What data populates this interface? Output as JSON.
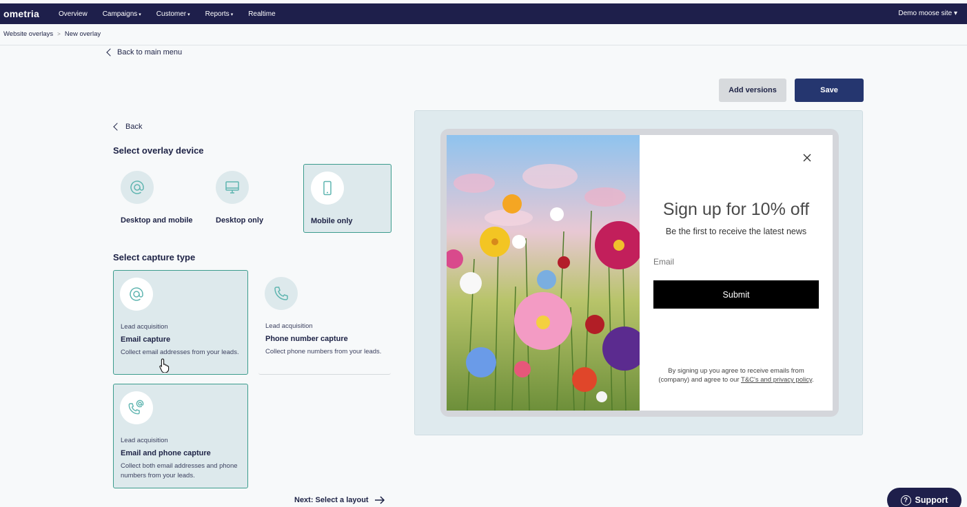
{
  "nav": {
    "logo": "ometria",
    "items": [
      "Overview",
      "Campaigns",
      "Customer",
      "Reports",
      "Realtime"
    ],
    "site": "Demo moose site"
  },
  "breadcrumb": [
    "Website overlays",
    "New overlay"
  ],
  "back_main": "Back to main menu",
  "actions": {
    "add_versions": "Add versions",
    "save": "Save"
  },
  "back": "Back",
  "device_section": {
    "title": "Select overlay device",
    "options": [
      {
        "label": "Desktop and mobile",
        "icon": "at-icon"
      },
      {
        "label": "Desktop only",
        "icon": "monitor-icon"
      },
      {
        "label": "Mobile only",
        "icon": "phone-icon",
        "selected": true
      }
    ]
  },
  "capture_section": {
    "title": "Select capture type",
    "options": [
      {
        "kicker": "Lead acquisition",
        "title": "Email capture",
        "desc": "Collect email addresses from your leads.",
        "icon": "at-icon",
        "selected": true
      },
      {
        "kicker": "Lead acquisition",
        "title": "Phone number capture",
        "desc": "Collect phone numbers from your leads.",
        "icon": "phone-call-icon"
      },
      {
        "kicker": "Lead acquisition",
        "title": "Email and phone capture",
        "desc": "Collect both email addresses and phone numbers from your leads.",
        "icon": "phone-at-icon",
        "selected": true
      }
    ]
  },
  "next": "Next: Select a layout",
  "preview": {
    "title": "Sign up for 10% off",
    "subtitle": "Be the first to receive the latest news",
    "email_placeholder": "Email",
    "submit": "Submit",
    "terms_text": "By signing up you agree to receive emails from (company) and agree to our",
    "terms_link": "T&C's and privacy policy"
  },
  "support": "Support",
  "colors": {
    "nav_bg": "#1e1f4b",
    "selected_bg": "#dde9ec",
    "selected_border": "#3a9b8c",
    "save_btn": "#25366f",
    "icon_teal": "#5fb5b0"
  }
}
